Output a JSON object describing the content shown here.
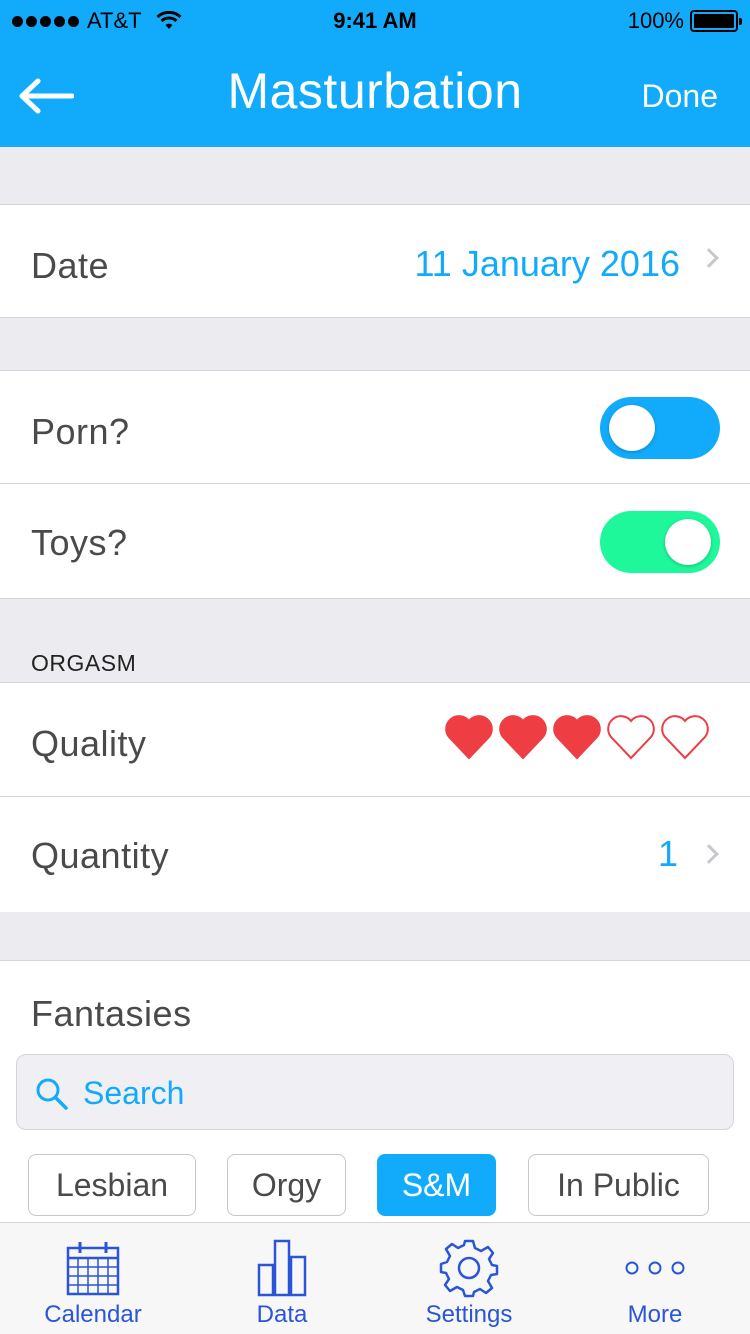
{
  "status_bar": {
    "carrier": "AT&T",
    "time": "9:41 AM",
    "battery": "100%"
  },
  "nav": {
    "title": "Masturbation",
    "done_label": "Done"
  },
  "date_row": {
    "label": "Date",
    "value": "11 January 2016"
  },
  "porn_row": {
    "label": "Porn?",
    "toggle_on": false
  },
  "toys_row": {
    "label": "Toys?",
    "toggle_on": true
  },
  "orgasm_section": {
    "title": "ORGASM"
  },
  "quality_row": {
    "label": "Quality",
    "rating": 3,
    "max_rating": 5
  },
  "quantity_row": {
    "label": "Quantity",
    "value": "1"
  },
  "fantasies": {
    "title": "Fantasies",
    "search_placeholder": "Search",
    "chips": [
      {
        "label": "Lesbian",
        "selected": false
      },
      {
        "label": "Orgy",
        "selected": false
      },
      {
        "label": "S&M",
        "selected": true
      },
      {
        "label": "In Public",
        "selected": false
      }
    ]
  },
  "tabbar": {
    "items": [
      {
        "label": "Calendar",
        "icon": "calendar-icon"
      },
      {
        "label": "Data",
        "icon": "bar-chart-icon"
      },
      {
        "label": "Settings",
        "icon": "gear-icon"
      },
      {
        "label": "More",
        "icon": "more-dots-icon"
      }
    ]
  },
  "colors": {
    "accent": "#12abfb",
    "toggle_on": "#1ef79a",
    "heart": "#ee3e43",
    "tab": "#2a55d6"
  }
}
